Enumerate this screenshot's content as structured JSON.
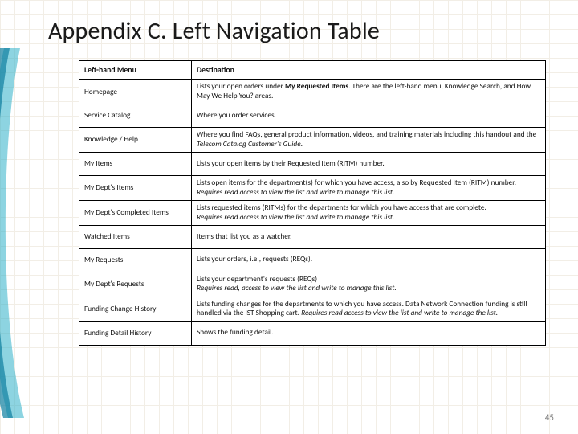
{
  "title": "Appendix C. Left Navigation Table",
  "page_number": "45",
  "table": {
    "headers": {
      "col1": "Left-hand Menu",
      "col2": "Destination"
    },
    "rows": [
      {
        "menu": "Homepage",
        "desc_parts": [
          {
            "t": "Lists your open orders under "
          },
          {
            "t": "My Requested Items",
            "b": true
          },
          {
            "t": ". There are the left-hand menu, Knowledge Search, and How May We Help You? areas."
          }
        ]
      },
      {
        "menu": "Service Catalog",
        "desc_parts": [
          {
            "t": "Where you order services."
          }
        ]
      },
      {
        "menu": "Knowledge / Help",
        "desc_parts": [
          {
            "t": "Where you find FAQs, general product information, videos, and training materials including this handout and the "
          },
          {
            "t": "Telecom Catalog Customer's Guide",
            "i": true
          },
          {
            "t": "."
          }
        ]
      },
      {
        "menu": "My Items",
        "desc_parts": [
          {
            "t": "Lists your open items by their Requested Item (RITM) number."
          }
        ]
      },
      {
        "menu": "My Dept's Items",
        "desc_parts": [
          {
            "t": "Lists open items for the department(s) for which you have access, also by Requested Item (RITM) number."
          },
          {
            "br": true
          },
          {
            "t": "Requires read access to view the list and write to manage this list.",
            "i": true
          }
        ]
      },
      {
        "menu": "My Dept's Completed Items",
        "desc_parts": [
          {
            "t": "Lists requested items (RITMs) for the departments for which you have access that are complete."
          },
          {
            "br": true
          },
          {
            "t": "Requires read access to view the list and write to manage this list.",
            "i": true
          }
        ]
      },
      {
        "menu": "Watched Items",
        "desc_parts": [
          {
            "t": "Items that list you as a watcher."
          }
        ]
      },
      {
        "menu": "My Requests",
        "desc_parts": [
          {
            "t": "Lists your orders, i.e., requests (REQs)."
          }
        ]
      },
      {
        "menu": "My Dept's Requests",
        "desc_parts": [
          {
            "t": "Lists your department's requests (REQs)"
          },
          {
            "br": true
          },
          {
            "t": "Requires read, access to view the list and write to manage this list.",
            "i": true
          }
        ]
      },
      {
        "menu": "Funding Change History",
        "desc_parts": [
          {
            "t": "Lists funding changes for the departments to which you have access. Data Network Connection funding is still handled via the IST Shopping cart. "
          },
          {
            "t": "Requires read access to view the list and write to manage the list.",
            "i": true
          }
        ]
      },
      {
        "menu": "Funding Detail History",
        "desc_parts": [
          {
            "t": "Shows the funding detail."
          }
        ]
      }
    ]
  }
}
